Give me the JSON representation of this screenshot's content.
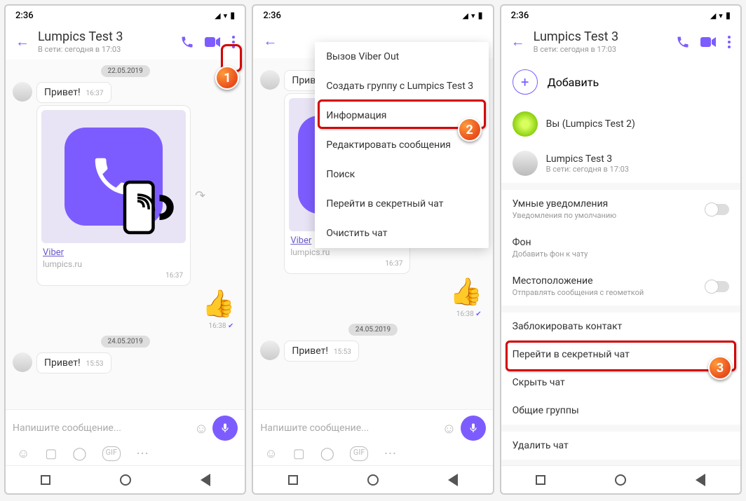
{
  "status": {
    "time": "2:36"
  },
  "header": {
    "title": "Lumpics Test 3",
    "subtitle": "В сети: сегодня в 17:03"
  },
  "chat": {
    "date1": "22.05.2019",
    "msg1": "Привет!",
    "msg1_time": "16:37",
    "link_label": "Viber",
    "link_domain": "lumpics.ru",
    "media_time": "16:37",
    "out_time": "16:38",
    "date2": "24.05.2019",
    "msg2": "Привет!",
    "msg2_time": "15:53",
    "placeholder": "Напишите сообщение..."
  },
  "menu": {
    "items": [
      "Вызов Viber Out",
      "Создать группу с Lumpics Test 3",
      "Информация",
      "Редактировать сообщения",
      "Поиск",
      "Перейти в секретный чат",
      "Очистить чат"
    ]
  },
  "info": {
    "add": "Добавить",
    "you": "Вы (Lumpics Test 2)",
    "contact_name": "Lumpics Test 3",
    "contact_status": "В сети: сегодня в 17:03",
    "smart_notif": "Умные уведомления",
    "smart_notif_sub": "Уведомления по умолчанию",
    "background": "Фон",
    "background_sub": "Добавить фон к чату",
    "location": "Местоположение",
    "location_sub": "Отправлять сообщения с геометкой",
    "block": "Заблокировать контакт",
    "secret": "Перейти в секретный чат",
    "hide": "Скрыть чат",
    "groups": "Общие группы",
    "delete": "Удалить чат"
  },
  "callouts": {
    "c1": "1",
    "c2": "2",
    "c3": "3"
  }
}
